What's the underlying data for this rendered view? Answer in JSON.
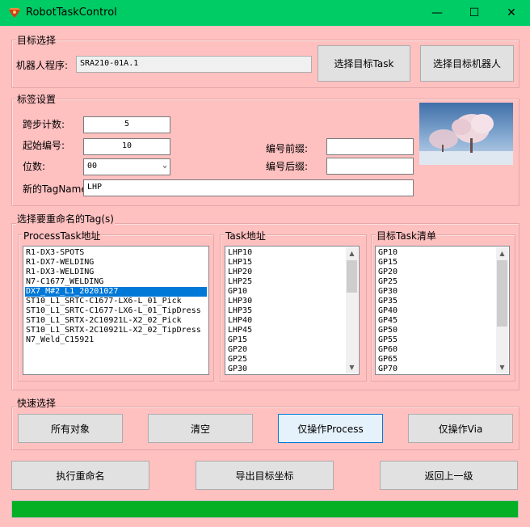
{
  "window": {
    "title": "RobotTaskControl",
    "minimize": "—",
    "maximize": "☐",
    "close": "✕"
  },
  "target_group": {
    "label": "目标选择",
    "robot_program_label": "机器人程序:",
    "robot_program_value": "SRA210-01A.1",
    "select_task_button": "选择目标Task",
    "select_robot_button": "选择目标机器人"
  },
  "tag_group": {
    "label": "标签设置",
    "step_label": "跨步计数:",
    "step_value": "5",
    "start_label": "起始编号:",
    "start_value": "10",
    "digits_label": "位数:",
    "digits_value": "00",
    "prefix_label": "编号前缀:",
    "prefix_value": "",
    "suffix_label": "编号后缀:",
    "suffix_value": "",
    "new_tagname_label": "新的TagName:",
    "new_tagname_value": "LHP"
  },
  "rename_group": {
    "label": "选择要重命名的Tag(s)",
    "process_task": {
      "label": "ProcessTask地址",
      "items": [
        "R1-DX3-SPOTS",
        "R1-DX7-WELDING",
        "R1-DX3-WELDING",
        "N7-C1677_WELDING",
        "DX7_M#2_L1_20201027",
        "ST10_L1_SRTC-C1677-LX6-L_01_Pick",
        "ST10_L1_SRTC-C1677-LX6-L_01_TipDress",
        "ST10_L1_SRTX-2C10921L-X2_02_Pick",
        "ST10_L1_SRTX-2C10921L-X2_02_TipDress",
        "N7_Weld_C15921"
      ],
      "selected_index": 4
    },
    "task_address": {
      "label": "Task地址",
      "items": [
        "LHP10",
        "LHP15",
        "LHP20",
        "LHP25",
        "GP10",
        "LHP30",
        "LHP35",
        "LHP40",
        "LHP45",
        "GP15",
        "GP20",
        "GP25",
        "GP30"
      ]
    },
    "target_task_list": {
      "label": "目标Task清单",
      "items": [
        "GP10",
        "GP15",
        "GP20",
        "GP25",
        "GP30",
        "GP35",
        "GP40",
        "GP45",
        "GP50",
        "GP55",
        "GP60",
        "GP65",
        "GP70"
      ]
    }
  },
  "quick_group": {
    "label": "快速选择",
    "all_button": "所有对象",
    "clear_button": "清空",
    "process_only_button": "仅操作Process",
    "via_only_button": "仅操作Via"
  },
  "actions": {
    "rename_button": "执行重命名",
    "export_button": "导出目标坐标",
    "back_button": "返回上一级"
  },
  "progress": {
    "value_percent": 100
  },
  "colors": {
    "titlebar": "#00cc66",
    "background": "#ffc0c0",
    "selection": "#0078d7",
    "progress": "#06b025"
  }
}
